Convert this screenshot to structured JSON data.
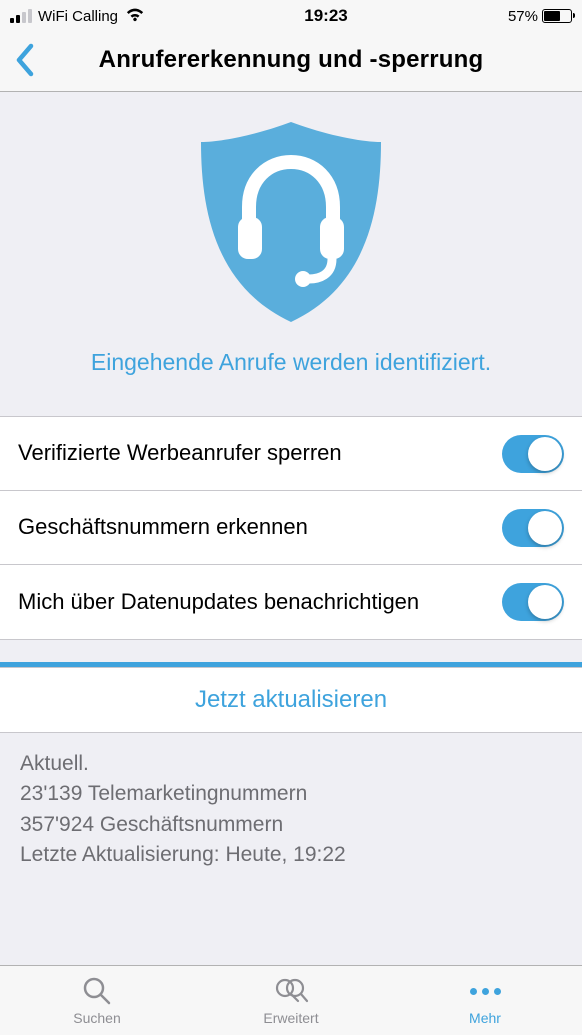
{
  "status_bar": {
    "carrier": "WiFi Calling",
    "time": "19:23",
    "battery_pct": "57%"
  },
  "header": {
    "title": "Anrufererkennung und -sperrung"
  },
  "hero": {
    "identified_text": "Eingehende Anrufe werden identifiziert."
  },
  "settings": [
    {
      "label": "Verifizierte Werbeanrufer sperren",
      "on": true
    },
    {
      "label": "Geschäftsnummern erkennen",
      "on": true
    },
    {
      "label": "Mich über Datenupdates benachrichtigen",
      "on": true
    }
  ],
  "action": {
    "update_now": "Jetzt aktualisieren"
  },
  "status": {
    "line1": "Aktuell.",
    "line2": "23'139 Telemarketingnummern",
    "line3": "357'924 Geschäftsnummern",
    "line4": "Letzte Aktualisierung: Heute, 19:22"
  },
  "tabs": {
    "search": "Suchen",
    "advanced": "Erweitert",
    "more": "Mehr"
  },
  "colors": {
    "accent": "#3ea3dd"
  }
}
